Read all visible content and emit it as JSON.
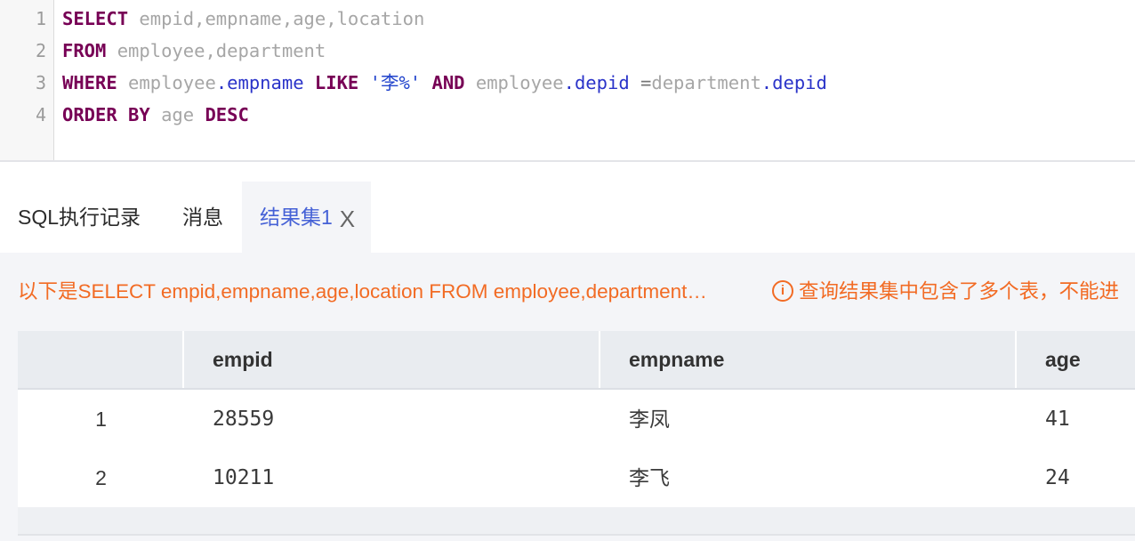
{
  "editor": {
    "line_numbers": [
      "1",
      "2",
      "3",
      "4"
    ],
    "lines": [
      [
        {
          "t": "SELECT",
          "c": "kw"
        },
        {
          "t": " ",
          "c": "id"
        },
        {
          "t": "empid,empname,age,location",
          "c": "id"
        }
      ],
      [
        {
          "t": "FROM",
          "c": "kw"
        },
        {
          "t": " employee,department",
          "c": "id"
        }
      ],
      [
        {
          "t": "WHERE",
          "c": "kw"
        },
        {
          "t": " employee",
          "c": "id"
        },
        {
          "t": ".empname",
          "c": "pr"
        },
        {
          "t": " ",
          "c": "id"
        },
        {
          "t": "LIKE",
          "c": "kw"
        },
        {
          "t": " ",
          "c": "id"
        },
        {
          "t": "'李%'",
          "c": "str"
        },
        {
          "t": " ",
          "c": "id"
        },
        {
          "t": "AND",
          "c": "kw"
        },
        {
          "t": " employee",
          "c": "id"
        },
        {
          "t": ".depid",
          "c": "pr"
        },
        {
          "t": " =",
          "c": "op"
        },
        {
          "t": "department",
          "c": "id"
        },
        {
          "t": ".depid",
          "c": "pr"
        }
      ],
      [
        {
          "t": "ORDER BY",
          "c": "kw"
        },
        {
          "t": " age ",
          "c": "id"
        },
        {
          "t": "DESC",
          "c": "kw"
        }
      ]
    ]
  },
  "tabs": {
    "history": "SQL执行记录",
    "messages": "消息",
    "result": "结果集1",
    "close_glyph": "X"
  },
  "info": {
    "summary": "以下是SELECT empid,empname,age,location FROM employee,department…",
    "warning_glyph": "i",
    "warning": "查询结果集中包含了多个表，不能进"
  },
  "table": {
    "headers": {
      "empid": "empid",
      "empname": "empname",
      "age": "age"
    },
    "rows": [
      {
        "index": "1",
        "empid": "28559",
        "empname": "李凤",
        "age": "41"
      },
      {
        "index": "2",
        "empid": "10211",
        "empname": "李飞",
        "age": "24"
      }
    ]
  },
  "colors": {
    "accent": "#4561d6",
    "warning": "#f26b24",
    "keyword": "#770055"
  }
}
